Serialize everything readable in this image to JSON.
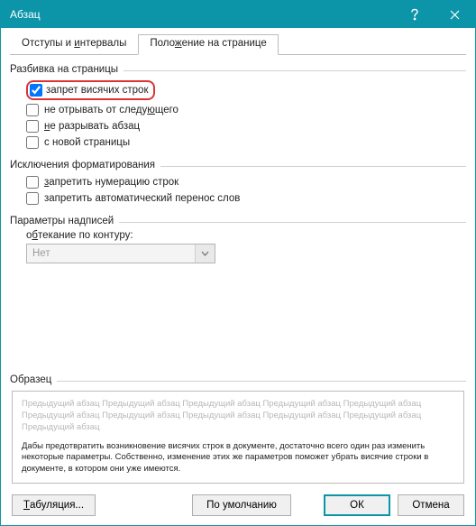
{
  "title": "Абзац",
  "tabs": {
    "t1_pre": "Отступы и ",
    "t1_u": "и",
    "t1_post": "нтервалы",
    "t2": "Поло",
    "t2_u": "ж",
    "t2_post": "ение на странице"
  },
  "groups": {
    "pagination": "Разбивка на страницы",
    "exceptions": "Исключения форматирования",
    "captions": "Параметры надписей",
    "sample": "Образец"
  },
  "checks": {
    "widow": "запрет висячих строк",
    "keepnext_pre": "не отрывать от следу",
    "keepnext_u": "ю",
    "keepnext_post": "щего",
    "keeplines_u": "н",
    "keeplines_post": "е разрывать абзац",
    "pagebreak": "с новой страницы",
    "nolinenum_u": "з",
    "nolinenum_post": "апретить нумерацию строк",
    "nohyphen": "запретить автоматический перенос слов"
  },
  "caption": {
    "label_pre": "о",
    "label_u": "б",
    "label_post": "текание по контуру:",
    "value": "Нет"
  },
  "sample": {
    "grey": "Предыдущий абзац Предыдущий абзац Предыдущий абзац Предыдущий абзац Предыдущий абзац Предыдущий абзац Предыдущий абзац Предыдущий абзац Предыдущий абзац Предыдущий абзац Предыдущий абзац",
    "black": "Дабы предотвратить возникновение висячих строк в документе, достаточно всего один раз изменить некоторые параметры. Собственно, изменение этих же параметров поможет убрать висячие строки в документе, в котором они уже имеются."
  },
  "buttons": {
    "tabs_btn_u": "Т",
    "tabs_btn_post": "абуляция...",
    "default": "По умолчанию",
    "ok": "ОК",
    "cancel": "Отмена"
  }
}
